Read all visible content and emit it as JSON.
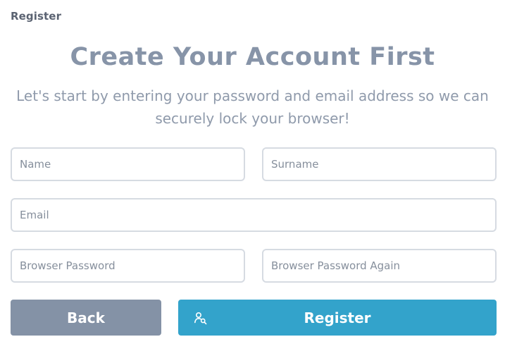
{
  "header": {
    "label": "Register"
  },
  "main": {
    "title": "Create Your Account First",
    "subtitle": "Let's start by entering your password and email address so we can securely lock your browser!"
  },
  "form": {
    "name": {
      "placeholder": "Name",
      "value": ""
    },
    "surname": {
      "placeholder": "Surname",
      "value": ""
    },
    "email": {
      "placeholder": "Email",
      "value": ""
    },
    "password": {
      "placeholder": "Browser Password",
      "value": ""
    },
    "password_again": {
      "placeholder": "Browser Password Again",
      "value": ""
    }
  },
  "actions": {
    "back_label": "Back",
    "register_label": "Register",
    "register_icon": "user-search-icon"
  },
  "colors": {
    "back_button": "#8492a6",
    "register_button": "#33a3cb",
    "title": "#8794a8"
  }
}
